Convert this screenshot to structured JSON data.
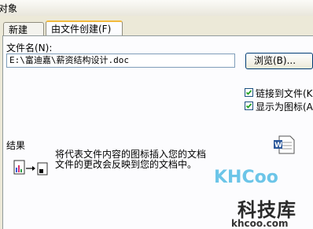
{
  "window": {
    "title": "对象"
  },
  "tabs": [
    {
      "label": "新建(C)"
    },
    {
      "label": "由文件创建(F)"
    }
  ],
  "form": {
    "filename_label": "文件名(N):",
    "filename_value": "E:\\富迪嘉\\薪资结构设计.doc",
    "browse_label": "浏览(B)...",
    "link_label": "链接到文件(K)",
    "link_checked": true,
    "display_icon_label": "显示为图标(A)",
    "display_icon_checked": true
  },
  "result": {
    "heading": "结果",
    "line1": "将代表文件内容的图标插入您的文档",
    "line2": "文件的更改会反映到您的文档中。"
  },
  "watermark": {
    "logo": "KHCoo",
    "name": "科技库",
    "url": "khcoo.com"
  },
  "colors": {
    "tab_highlight": "#f1b93c",
    "face": "#ece9d8",
    "panel": "#fcfcfe"
  }
}
